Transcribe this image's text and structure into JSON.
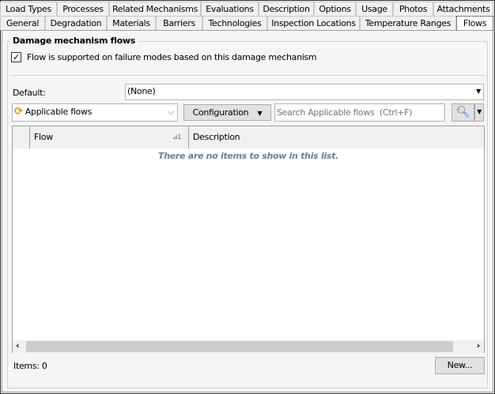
{
  "tabs_row1": [
    "Load Types",
    "Processes",
    "Related Mechanisms",
    "Evaluations",
    "Description",
    "Options",
    "Usage",
    "Photos",
    "Attachments"
  ],
  "tabs_row2": [
    "General",
    "Degradation",
    "Materials",
    "Barriers",
    "Technologies",
    "Inspection Locations",
    "Temperature Ranges",
    "Flows"
  ],
  "group": {
    "title": "Damage mechanism flows",
    "checkbox_label": "Flow is supported on failure modes based on this damage mechanism",
    "checked": true
  },
  "default": {
    "label": "Default:",
    "value": "(None)"
  },
  "toolbar": {
    "view": "Applicable flows",
    "configuration": "Configuration",
    "search_placeholder": "Search Applicable flows  (Ctrl+F)"
  },
  "grid": {
    "columns": [
      "Flow",
      "Description"
    ],
    "sort_indicator": "1",
    "empty_text": "There are no items to show in this list."
  },
  "footer": {
    "items": "Items: 0",
    "new_button": "New..."
  }
}
